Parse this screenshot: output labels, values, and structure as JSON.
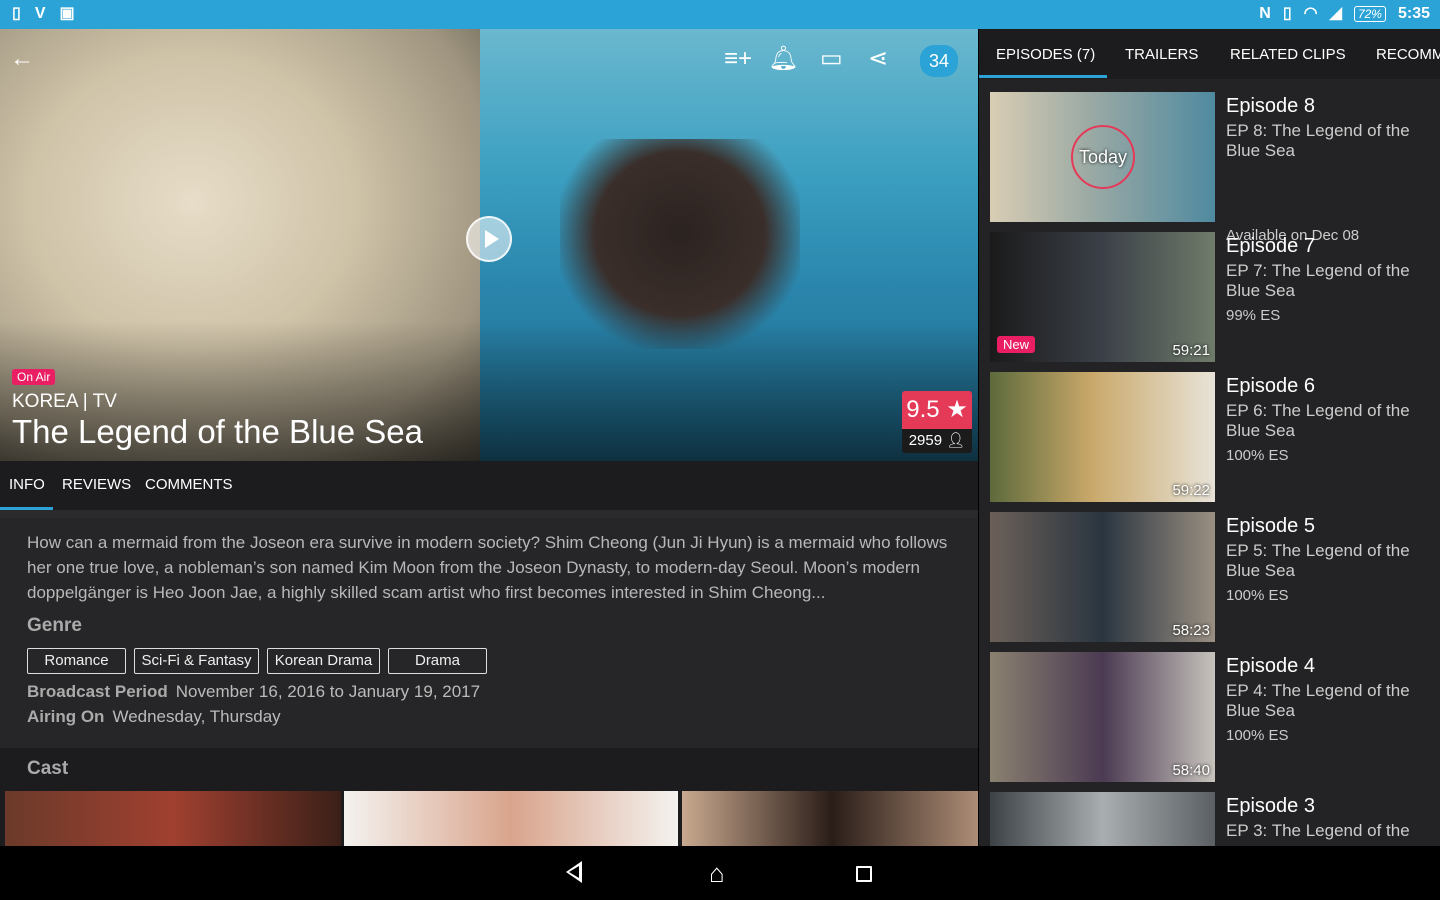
{
  "status_bar": {
    "left_icons": [
      "sim-card-icon",
      "vlive-icon",
      "image-icon"
    ],
    "battery": "72%",
    "time": "5:35"
  },
  "hero": {
    "on_air": "On Air",
    "country": "KOREA | TV",
    "title": "The Legend of the Blue Sea",
    "rating": "9.5 ★",
    "rating_count": "2959",
    "comment_count": "34"
  },
  "left_tabs": [
    "INFO",
    "REVIEWS",
    "COMMENTS"
  ],
  "info": {
    "description": "How can a mermaid from the Joseon era survive in modern society? Shim Cheong (Jun Ji Hyun) is a mermaid who follows her one true love, a nobleman’s son named Kim Moon from the Joseon Dynasty, to modern-day Seoul. Moon’s modern doppelgänger is Heo Joon Jae, a highly skilled scam artist who first becomes interested in Shim Cheong...",
    "genre_heading": "Genre",
    "genres": [
      "Romance",
      "Sci-Fi & Fantasy",
      "Korean Drama",
      "Drama"
    ],
    "broadcast_label": "Broadcast Period",
    "broadcast_value": "November 16, 2016 to January 19, 2017",
    "airing_label": "Airing On",
    "airing_value": "Wednesday, Thursday",
    "cast_heading": "Cast"
  },
  "right_tabs": [
    "EPISODES (7)",
    "TRAILERS",
    "RELATED CLIPS",
    "RECOMM"
  ],
  "episodes": [
    {
      "title": "Episode 8",
      "subtitle": "EP 8: The Legend of the Blue Sea",
      "extra": "Available on Dec 08",
      "duration": "",
      "badge": "Today"
    },
    {
      "title": "Episode 7",
      "subtitle": "EP 7: The Legend of the Blue Sea",
      "extra": "99% ES",
      "duration": "59:21",
      "badge": "New"
    },
    {
      "title": "Episode 6",
      "subtitle": "EP 6: The Legend of the Blue Sea",
      "extra": "100% ES",
      "duration": "59:22",
      "badge": ""
    },
    {
      "title": "Episode 5",
      "subtitle": "EP 5: The Legend of the Blue Sea",
      "extra": "100% ES",
      "duration": "58:23",
      "badge": ""
    },
    {
      "title": "Episode 4",
      "subtitle": "EP 4: The Legend of the Blue Sea",
      "extra": "100% ES",
      "duration": "58:40",
      "badge": ""
    },
    {
      "title": "Episode 3",
      "subtitle": "EP 3: The Legend of the",
      "extra": "",
      "duration": "",
      "badge": ""
    }
  ],
  "colors": {
    "accent": "#2ba3d6",
    "rating": "#e53958",
    "badge": "#e91e63"
  }
}
